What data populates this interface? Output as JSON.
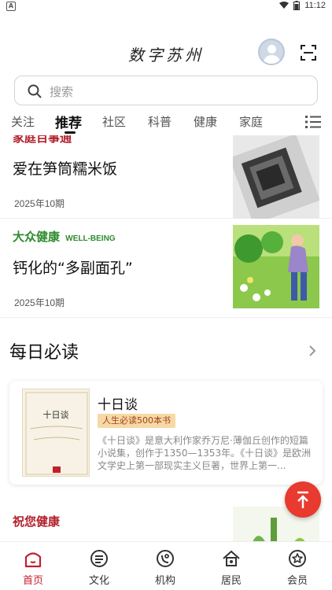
{
  "status_bar": {
    "time": "11:12",
    "left_icon": "A"
  },
  "header": {
    "app_title": "数字苏州"
  },
  "search": {
    "placeholder": "搜索"
  },
  "tabs": [
    {
      "label": "关注"
    },
    {
      "label": "推荐"
    },
    {
      "label": "社区"
    },
    {
      "label": "科普"
    },
    {
      "label": "健康"
    },
    {
      "label": "家庭"
    }
  ],
  "articles": [
    {
      "brand": "家庭百事通",
      "title": "爱在笋筒糯米饭",
      "issue": "2025年10期"
    },
    {
      "brand": "大众健康",
      "brand_sub": "WELL-BEING",
      "title": "钙化的“多副面孔”",
      "issue": "2025年10期"
    },
    {
      "brand": "祝您健康",
      "title": ""
    }
  ],
  "daily": {
    "section_title": "每日必读",
    "book": {
      "title": "十日谈",
      "cover_title": "十日谈",
      "badge": "人生必读500本书",
      "description": "《十日谈》是意大利作家乔万尼·薄伽丘创作的短篇小说集，创作于1350—1353年。《十日谈》是欧洲文学史上第一部现实主义巨著，世界上第一..."
    }
  },
  "bottom_nav": [
    {
      "label": "首页",
      "icon": "home-icon"
    },
    {
      "label": "文化",
      "icon": "culture-icon"
    },
    {
      "label": "机构",
      "icon": "institution-icon"
    },
    {
      "label": "居民",
      "icon": "resident-icon"
    },
    {
      "label": "会员",
      "icon": "member-icon"
    }
  ],
  "colors": {
    "accent": "#c21f2c",
    "fab": "#e83a2f",
    "brand_green": "#2e8b2e"
  }
}
